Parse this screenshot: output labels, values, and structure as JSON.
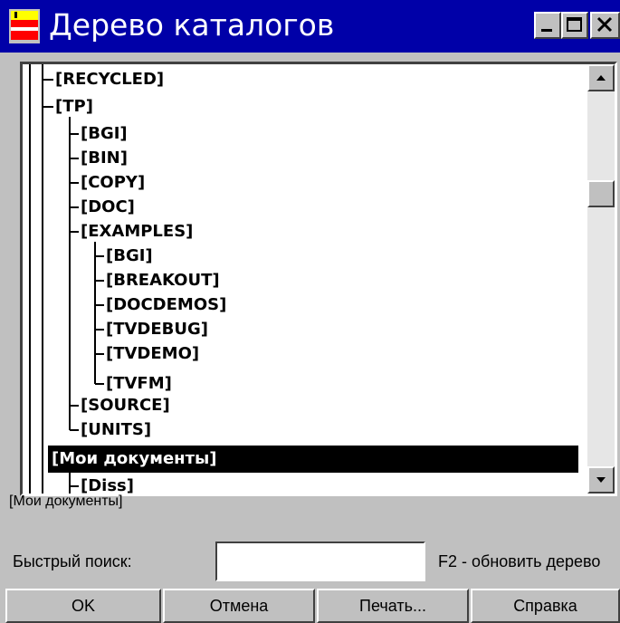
{
  "window": {
    "title": "Дерево каталогов",
    "title_bar_color": "#0000a8",
    "face_color": "#c0c0c0",
    "controls": [
      "minimize-icon",
      "maximize-icon",
      "close-icon"
    ]
  },
  "tree": {
    "nodes": [
      {
        "label": "[RECYCLED]",
        "level": 1
      },
      {
        "label": "[TP]",
        "level": 1
      },
      {
        "label": "[BGI]",
        "level": 2
      },
      {
        "label": "[BIN]",
        "level": 2
      },
      {
        "label": "[COPY]",
        "level": 2
      },
      {
        "label": "[DOC]",
        "level": 2
      },
      {
        "label": "[EXAMPLES]",
        "level": 2
      },
      {
        "label": "[BGI]",
        "level": 3
      },
      {
        "label": "[BREAKOUT]",
        "level": 3
      },
      {
        "label": "[DOCDEMOS]",
        "level": 3
      },
      {
        "label": "[TVDEBUG]",
        "level": 3
      },
      {
        "label": "[TVDEMO]",
        "level": 3
      },
      {
        "label": "[TVFM]",
        "level": 3
      },
      {
        "label": "[SOURCE]",
        "level": 2
      },
      {
        "label": "[UNITS]",
        "level": 2
      },
      {
        "label": "[Мои документы]",
        "level": 1,
        "selected": true
      },
      {
        "label": "[Diss]",
        "level": 2
      }
    ]
  },
  "status": {
    "current_path": "[Мои документы]"
  },
  "search": {
    "label": "Быстрый поиск:",
    "value": "",
    "hint": "F2 - обновить дерево"
  },
  "buttons": {
    "ok": "OK",
    "cancel": "Отмена",
    "print": "Печать...",
    "help": "Справка"
  }
}
